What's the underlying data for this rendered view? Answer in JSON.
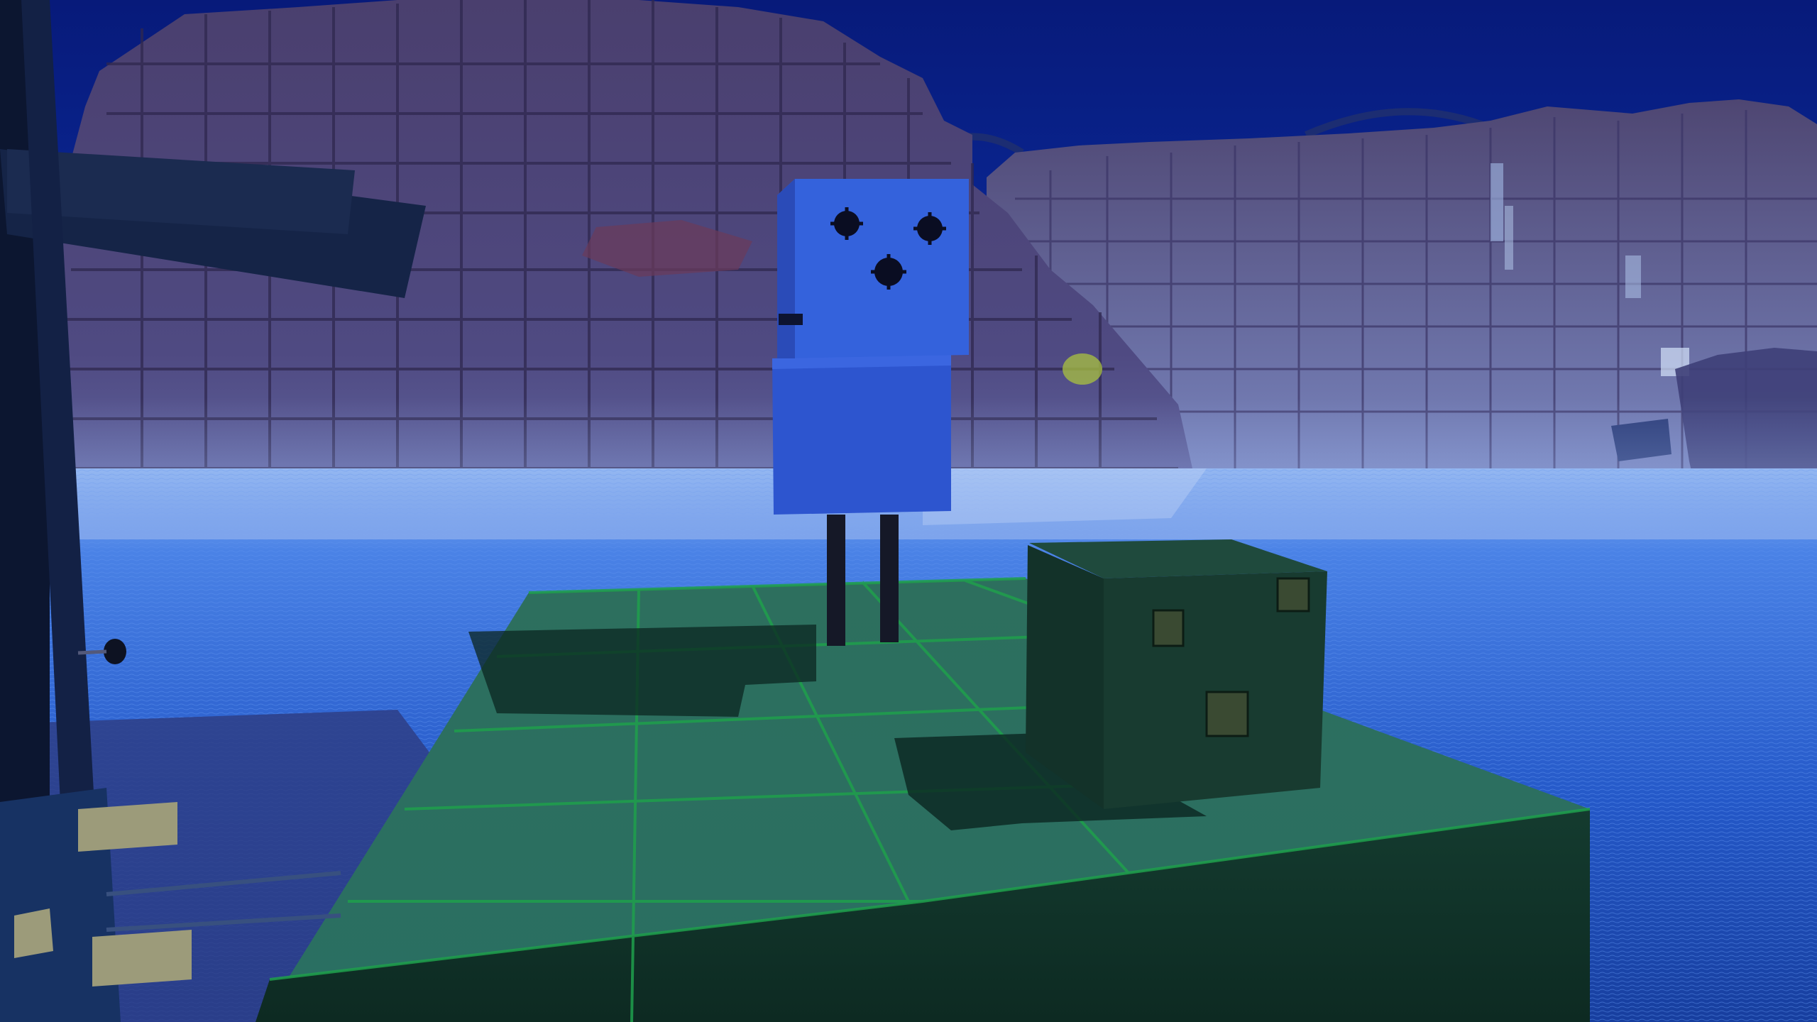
{
  "scene": {
    "kind": "3d-game-viewport",
    "time_of_day": "night",
    "hud": {},
    "objects": [
      {
        "id": "blue-robot-character",
        "color": "#2f4fc9"
      },
      {
        "id": "green-metal-crate",
        "color": "#17352c"
      },
      {
        "id": "green-tiled-platform",
        "color": "#2a6b5a"
      },
      {
        "id": "rock-cliffs",
        "color": "#4a4477"
      },
      {
        "id": "glowing-water",
        "color": "#2a63d6"
      },
      {
        "id": "dark-scaffold-structure",
        "color": "#0e1f3f"
      }
    ]
  }
}
